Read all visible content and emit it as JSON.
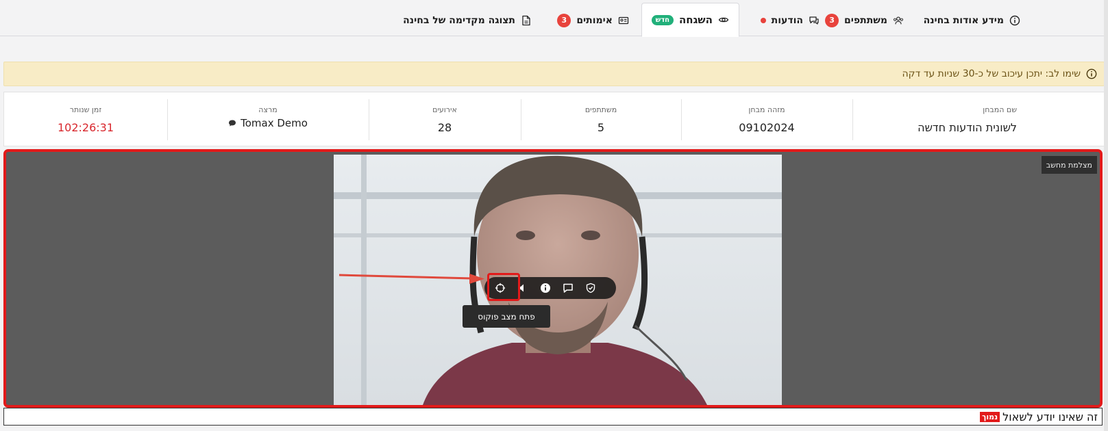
{
  "tabs": [
    {
      "label": "מידע אודות בחינה",
      "icon": "info-icon"
    },
    {
      "label": "משתתפים",
      "icon": "users-icon",
      "badge": "3"
    },
    {
      "label": "הודעות",
      "icon": "chat-icon"
    },
    {
      "label": "השגחה",
      "icon": "eye-icon",
      "badge_new": "חדש",
      "active": true
    },
    {
      "label": "אימותים",
      "icon": "id-card-icon",
      "badge": "3"
    },
    {
      "label": "תצוגה מקדימה של בחינה",
      "icon": "document-icon"
    }
  ],
  "alert": {
    "text": "שימו לב: יתכן עיכוב של כ-30 שניות עד דקה",
    "icon": "info-icon"
  },
  "stats": {
    "exam_name": {
      "label": "שם המבחן",
      "value": "לשונית הודעות חדשה"
    },
    "exam_id": {
      "label": "מזהה מבחן",
      "value": "09102024"
    },
    "participants": {
      "label": "משתתפים",
      "value": "5"
    },
    "events": {
      "label": "אירועים",
      "value": "28"
    },
    "lecturer": {
      "label": "מרצה",
      "value": "Tomax Demo"
    },
    "time_left": {
      "label": "זמן שנותר",
      "value": "102:26:31"
    }
  },
  "camera": {
    "label": "מצלמת מחשב"
  },
  "toolbar": {
    "tooltip": "פתח מצב פוקוס",
    "buttons": [
      "shield-check-icon",
      "message-icon",
      "info-icon",
      "volume-icon",
      "crosshair-icon"
    ]
  },
  "caption": {
    "tag": "נמוך",
    "text": "זה שאינו יודע לשאול"
  },
  "colors": {
    "accent_red": "#e21a1a",
    "badge_red": "#e8433c",
    "badge_green": "#21b07a",
    "alert_bg": "#f8ecc6",
    "time_red": "#d8262c"
  }
}
